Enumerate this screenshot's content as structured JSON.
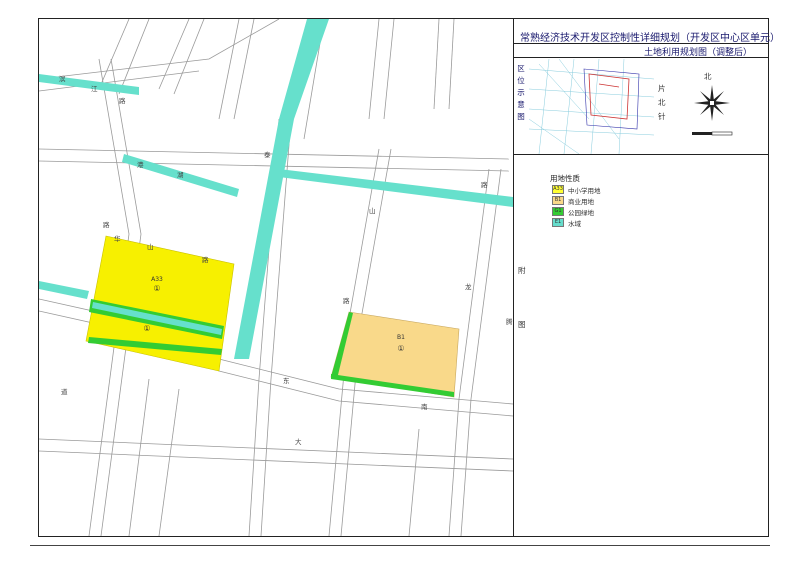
{
  "title": {
    "main": "常熟经济技术开发区控制性详细规划（开发区中心区单元）",
    "sub": "土地利用规划图（调整后）"
  },
  "index_map_label": [
    "区",
    "位",
    "示",
    "意",
    "图"
  ],
  "north_label": "北",
  "site_label": [
    "片",
    "北",
    "针"
  ],
  "legend": {
    "title": "用地性质",
    "items": [
      {
        "code": "A33",
        "label": "中小学用地",
        "color": "#ffff33"
      },
      {
        "code": "B1",
        "label": "商业用地",
        "color": "#f9d98a"
      },
      {
        "code": "G1",
        "label": "公园绿地",
        "color": "#33cc33"
      },
      {
        "code": "E1",
        "label": "水域",
        "color": "#66ddcc"
      }
    ]
  },
  "side_notes": [
    "附",
    "图"
  ],
  "parcels": [
    {
      "code": "A33",
      "id": "①",
      "color": "#f7f000"
    },
    {
      "code": "B1",
      "id": "①",
      "color": "#f9d98a"
    }
  ],
  "road_labels": [
    "滨",
    "江",
    "路",
    "港",
    "湖",
    "路",
    "华",
    "山",
    "路",
    "泰",
    "山",
    "路",
    "龙",
    "腾",
    "路",
    "东",
    "南",
    "大",
    "道"
  ],
  "colors": {
    "water": "#66e0cc",
    "school": "#f7f000",
    "commercial": "#f9d98a",
    "green": "#33cc33",
    "road": "#aaaaaa"
  }
}
